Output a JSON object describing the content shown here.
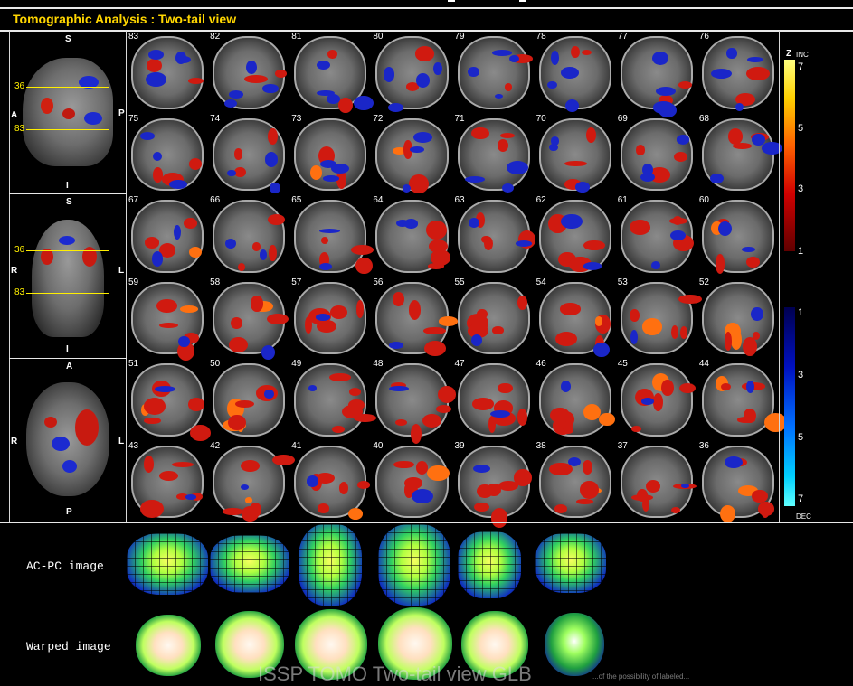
{
  "header": {
    "title": "Tomographic Analysis : Two-tail view"
  },
  "reference_views": {
    "sagittal": {
      "top": "S",
      "bottom": "I",
      "left": "A",
      "right": "P",
      "line_upper": "36",
      "line_lower": "83"
    },
    "coronal": {
      "top": "S",
      "bottom": "I",
      "left": "R",
      "right": "L",
      "line_upper": "36",
      "line_lower": "83"
    },
    "axial": {
      "top": "A",
      "bottom": "P",
      "left": "R",
      "right": "L"
    }
  },
  "slices": {
    "rows": [
      [
        "83",
        "82",
        "81",
        "80",
        "79",
        "78",
        "77",
        "76"
      ],
      [
        "75",
        "74",
        "73",
        "72",
        "71",
        "70",
        "69",
        "68"
      ],
      [
        "67",
        "66",
        "65",
        "64",
        "63",
        "62",
        "61",
        "60"
      ],
      [
        "59",
        "58",
        "57",
        "56",
        "55",
        "54",
        "53",
        "52"
      ],
      [
        "51",
        "50",
        "49",
        "48",
        "47",
        "46",
        "45",
        "44"
      ],
      [
        "43",
        "42",
        "41",
        "40",
        "39",
        "38",
        "37",
        "36"
      ]
    ]
  },
  "colorbar": {
    "z_label": "Z",
    "inc_label": "INC",
    "dec_label": "DEC",
    "inc_ticks": [
      "7",
      "5",
      "3",
      "1"
    ],
    "dec_ticks": [
      "1",
      "3",
      "5",
      "7"
    ],
    "inc_colors": [
      "#ffff60",
      "#ffb000",
      "#ff4000",
      "#c00000",
      "#500000"
    ],
    "dec_colors": [
      "#000040",
      "#0000c0",
      "#0060ff",
      "#00c0ff",
      "#60ffff"
    ]
  },
  "bottom_rows": {
    "acpc_label": "AC-PC image",
    "warped_label": "Warped image"
  },
  "watermark": {
    "main": "ISSP TOMO Two-tail view GLB",
    "sub": "...of the possibility of labeled..."
  }
}
